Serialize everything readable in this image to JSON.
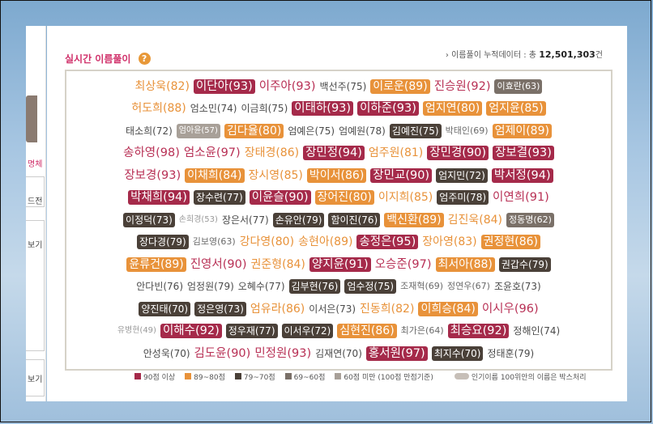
{
  "header": {
    "title": "실시간 이름풀이",
    "help_icon": "question-circle-icon",
    "counter_prefix": "› 이름풀이 누적데이터 : 총",
    "counter_value": "12,501,303",
    "counter_unit": "건"
  },
  "colors": {
    "tier1": "#a52a4a",
    "tier2": "#e8923a",
    "tier3": "#4a4038",
    "tier4": "#7a7068",
    "tier5": "#a8a098"
  },
  "left_panel": {
    "labels": [
      "명체",
      "드전",
      "보기",
      "보기"
    ]
  },
  "names": [
    [
      {
        "t": "최상욱(82)",
        "s": 2,
        "b": 0
      },
      {
        "t": "이단아(93)",
        "s": 1,
        "b": 1
      },
      {
        "t": "이주아(93)",
        "s": 1,
        "b": 0
      },
      {
        "t": "백선주(75)",
        "s": 3,
        "b": 0
      },
      {
        "t": "이로운(89)",
        "s": 2,
        "b": 1
      },
      {
        "t": "진승원(92)",
        "s": 1,
        "b": 0
      },
      {
        "t": "이효란(63)",
        "s": 4,
        "b": 1
      }
    ],
    [
      {
        "t": "허도희(88)",
        "s": 2,
        "b": 0
      },
      {
        "t": "엄소민(74)",
        "s": 3,
        "b": 0
      },
      {
        "t": "이금희(75)",
        "s": 3,
        "b": 0
      },
      {
        "t": "이태하(93)",
        "s": 1,
        "b": 1
      },
      {
        "t": "이하준(93)",
        "s": 1,
        "b": 1
      },
      {
        "t": "엄지연(80)",
        "s": 2,
        "b": 1
      },
      {
        "t": "엄지윤(85)",
        "s": 2,
        "b": 1
      }
    ],
    [
      {
        "t": "태소희(72)",
        "s": 3,
        "b": 0
      },
      {
        "t": "엄아윤(57)",
        "s": 5,
        "b": 1
      },
      {
        "t": "김다율(80)",
        "s": 2,
        "b": 1
      },
      {
        "t": "엄예은(75)",
        "s": 3,
        "b": 0
      },
      {
        "t": "엄예원(78)",
        "s": 3,
        "b": 0
      },
      {
        "t": "김예진(75)",
        "s": 3,
        "b": 1
      },
      {
        "t": "박태인(69)",
        "s": 4,
        "b": 0
      },
      {
        "t": "엄제이(89)",
        "s": 2,
        "b": 1
      }
    ],
    [
      {
        "t": "송하영(98)",
        "s": 1,
        "b": 0
      },
      {
        "t": "엄소윤(97)",
        "s": 1,
        "b": 0
      },
      {
        "t": "장태경(86)",
        "s": 2,
        "b": 0
      },
      {
        "t": "장민정(94)",
        "s": 1,
        "b": 1
      },
      {
        "t": "엄주원(81)",
        "s": 2,
        "b": 0
      },
      {
        "t": "장민경(90)",
        "s": 1,
        "b": 1
      },
      {
        "t": "장보결(93)",
        "s": 1,
        "b": 1
      }
    ],
    [
      {
        "t": "장보경(93)",
        "s": 1,
        "b": 0
      },
      {
        "t": "이채희(84)",
        "s": 2,
        "b": 1
      },
      {
        "t": "장시영(85)",
        "s": 2,
        "b": 0
      },
      {
        "t": "박이서(86)",
        "s": 2,
        "b": 1
      },
      {
        "t": "장민교(90)",
        "s": 1,
        "b": 1
      },
      {
        "t": "엄지민(72)",
        "s": 3,
        "b": 1
      },
      {
        "t": "박서정(94)",
        "s": 1,
        "b": 1
      }
    ],
    [
      {
        "t": "박채희(94)",
        "s": 1,
        "b": 1
      },
      {
        "t": "장수련(77)",
        "s": 3,
        "b": 1
      },
      {
        "t": "이윤슬(90)",
        "s": 1,
        "b": 1
      },
      {
        "t": "장어진(80)",
        "s": 2,
        "b": 1
      },
      {
        "t": "이지희(85)",
        "s": 2,
        "b": 0
      },
      {
        "t": "엄주미(78)",
        "s": 3,
        "b": 1
      },
      {
        "t": "이연희(91)",
        "s": 1,
        "b": 0
      }
    ],
    [
      {
        "t": "이정덕(73)",
        "s": 3,
        "b": 1
      },
      {
        "t": "손희경(53)",
        "s": 5,
        "b": 0
      },
      {
        "t": "장은서(77)",
        "s": 3,
        "b": 0
      },
      {
        "t": "손유안(79)",
        "s": 3,
        "b": 1
      },
      {
        "t": "함이진(76)",
        "s": 3,
        "b": 1
      },
      {
        "t": "백신환(89)",
        "s": 2,
        "b": 1
      },
      {
        "t": "김진욱(84)",
        "s": 2,
        "b": 0
      },
      {
        "t": "정동명(62)",
        "s": 4,
        "b": 1
      }
    ],
    [
      {
        "t": "장다경(79)",
        "s": 3,
        "b": 1
      },
      {
        "t": "김보영(63)",
        "s": 4,
        "b": 0
      },
      {
        "t": "강다영(80)",
        "s": 2,
        "b": 0
      },
      {
        "t": "송현아(89)",
        "s": 2,
        "b": 0
      },
      {
        "t": "송정은(95)",
        "s": 1,
        "b": 1
      },
      {
        "t": "장아영(83)",
        "s": 2,
        "b": 0
      },
      {
        "t": "권정현(86)",
        "s": 2,
        "b": 1
      }
    ],
    [
      {
        "t": "윤류건(89)",
        "s": 2,
        "b": 1
      },
      {
        "t": "진영서(90)",
        "s": 1,
        "b": 0
      },
      {
        "t": "권준형(84)",
        "s": 2,
        "b": 0
      },
      {
        "t": "양지윤(91)",
        "s": 1,
        "b": 1
      },
      {
        "t": "오승준(97)",
        "s": 1,
        "b": 0
      },
      {
        "t": "최서아(88)",
        "s": 2,
        "b": 1
      },
      {
        "t": "권갑수(79)",
        "s": 3,
        "b": 1
      }
    ],
    [
      {
        "t": "안다빈(76)",
        "s": 3,
        "b": 0
      },
      {
        "t": "엄정원(79)",
        "s": 3,
        "b": 0
      },
      {
        "t": "오혜수(77)",
        "s": 3,
        "b": 0
      },
      {
        "t": "김부현(76)",
        "s": 3,
        "b": 1
      },
      {
        "t": "엄수정(75)",
        "s": 3,
        "b": 1
      },
      {
        "t": "조재혁(69)",
        "s": 4,
        "b": 0
      },
      {
        "t": "정연우(67)",
        "s": 4,
        "b": 0
      },
      {
        "t": "조윤호(73)",
        "s": 3,
        "b": 0
      }
    ],
    [
      {
        "t": "양진태(70)",
        "s": 3,
        "b": 1
      },
      {
        "t": "정은영(73)",
        "s": 3,
        "b": 1
      },
      {
        "t": "엄유라(86)",
        "s": 2,
        "b": 0
      },
      {
        "t": "이서은(73)",
        "s": 3,
        "b": 0
      },
      {
        "t": "진동희(82)",
        "s": 2,
        "b": 0
      },
      {
        "t": "이희승(84)",
        "s": 2,
        "b": 1
      },
      {
        "t": "이시우(96)",
        "s": 1,
        "b": 0
      }
    ],
    [
      {
        "t": "유병현(49)",
        "s": 5,
        "b": 0
      },
      {
        "t": "이해수(92)",
        "s": 1,
        "b": 1
      },
      {
        "t": "정우재(77)",
        "s": 3,
        "b": 1
      },
      {
        "t": "이서우(72)",
        "s": 3,
        "b": 1
      },
      {
        "t": "심현진(86)",
        "s": 2,
        "b": 1
      },
      {
        "t": "최가은(64)",
        "s": 4,
        "b": 0
      },
      {
        "t": "최승요(92)",
        "s": 1,
        "b": 1
      },
      {
        "t": "정해인(74)",
        "s": 3,
        "b": 0
      }
    ],
    [
      {
        "t": "안성욱(70)",
        "s": 3,
        "b": 0
      },
      {
        "t": "김도윤(90)",
        "s": 1,
        "b": 0
      },
      {
        "t": "민정원(93)",
        "s": 1,
        "b": 0
      },
      {
        "t": "김재연(70)",
        "s": 3,
        "b": 0
      },
      {
        "t": "홍서원(97)",
        "s": 1,
        "b": 1
      },
      {
        "t": "최지수(70)",
        "s": 3,
        "b": 1
      },
      {
        "t": "정태훈(79)",
        "s": 3,
        "b": 0
      }
    ]
  ],
  "legend": {
    "items": [
      {
        "label": "90점 이상",
        "color": "#a52a4a"
      },
      {
        "label": "89~80점",
        "color": "#e8923a"
      },
      {
        "label": "79~70점",
        "color": "#4a4038"
      },
      {
        "label": "69~60점",
        "color": "#7a7068"
      },
      {
        "label": "60점 미만 (100점 만점기준)",
        "color": "#a8a098"
      }
    ],
    "box_note": "인기이름 100위안의 이름은 박스처리"
  }
}
